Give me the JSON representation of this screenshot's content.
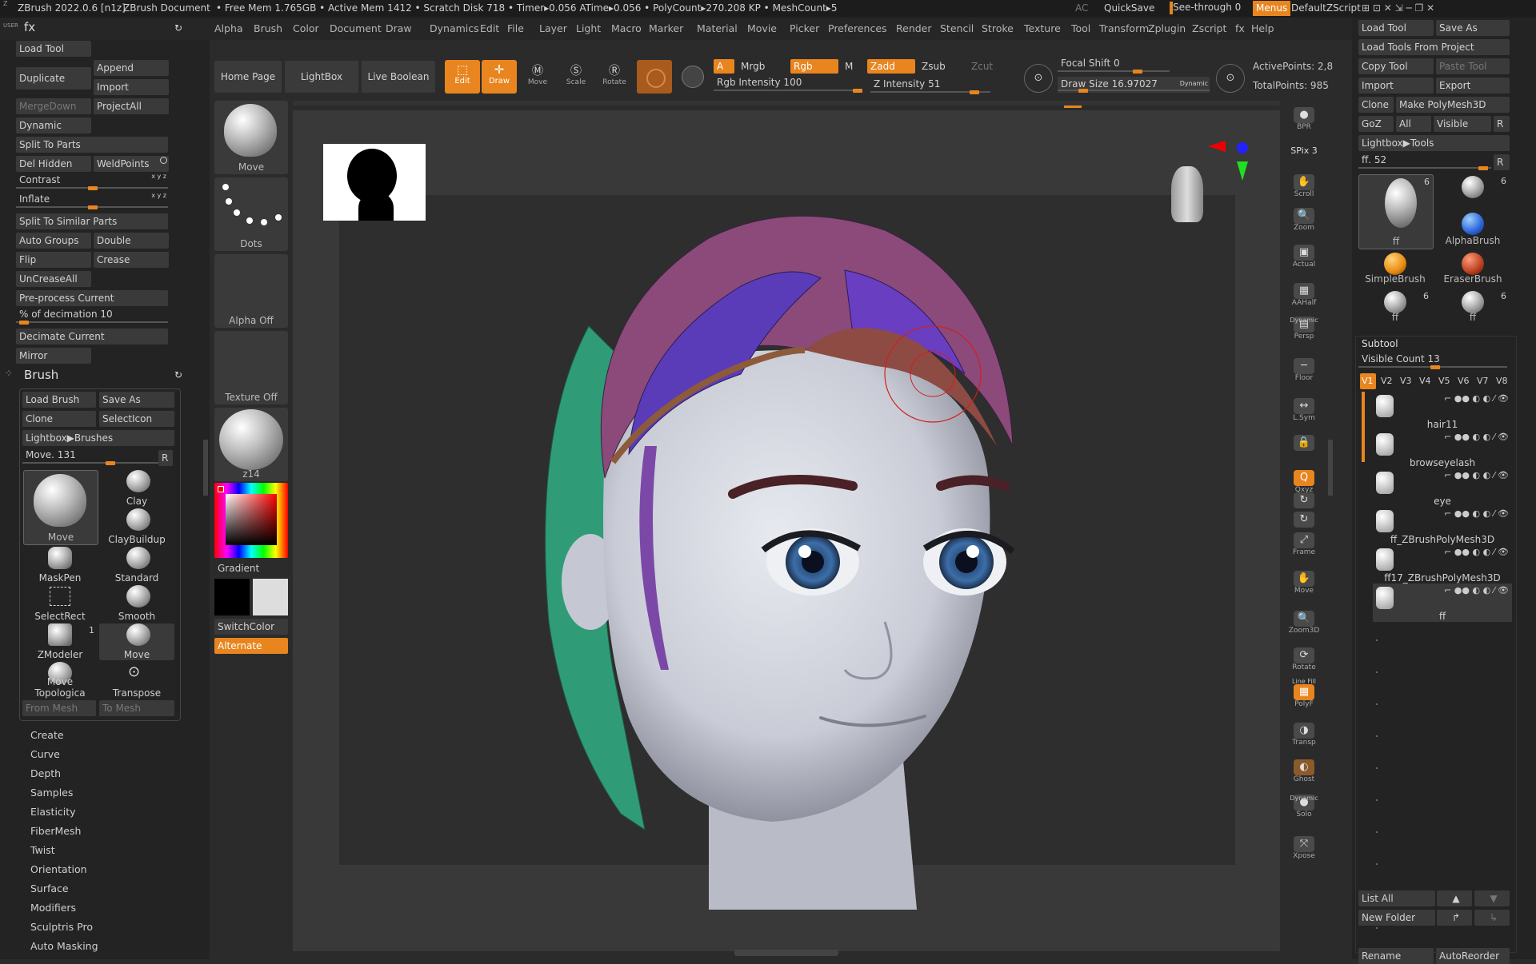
{
  "topbar": {
    "app_title": "ZBrush 2022.0.6 [n1z]",
    "document": "ZBrush Document",
    "stats": "• Free Mem 1.765GB • Active Mem 1412 • Scratch Disk 718 • Timer▸0.056 ATime▸0.056 • PolyCount▸270.208 KP • MeshCount▸5",
    "ac": "AC",
    "quicksave": "QuickSave",
    "see_through": "See-through  0",
    "menus": "Menus",
    "default_script": "DefaultZScript"
  },
  "menu": [
    "Alpha",
    "Brush",
    "Color",
    "Document",
    "Draw",
    "Dynamics",
    "Edit",
    "File",
    "Layer",
    "Light",
    "Macro",
    "Marker",
    "Material",
    "Movie",
    "Picker",
    "Preferences",
    "Render",
    "Stencil",
    "Stroke",
    "Texture",
    "Tool",
    "Transform",
    "Zplugin",
    "Zscript",
    "fx",
    "Help"
  ],
  "left": {
    "user": "USER",
    "fx": "fx",
    "buttons": {
      "load_tool": "Load Tool",
      "duplicate": "Duplicate",
      "append": "Append",
      "import": "Import",
      "mergedown": "MergeDown",
      "projectall": "ProjectAll",
      "dynamic": "Dynamic",
      "split_to_parts": "Split To Parts",
      "del_hidden": "Del Hidden",
      "weldpoints": "WeldPoints",
      "split_similar": "Split To Similar Parts",
      "auto_groups": "Auto Groups",
      "double": "Double",
      "flip": "Flip",
      "crease": "Crease",
      "uncreaseall": "UnCreaseAll",
      "preprocess": "Pre-process Current",
      "decimate_current": "Decimate Current",
      "mirror": "Mirror"
    },
    "contrast": "Contrast",
    "inflate": "Inflate",
    "xyz": "x y z",
    "decimation": "% of decimation 10",
    "brush_header": "Brush",
    "brush": {
      "load_brush": "Load Brush",
      "save_as": "Save As",
      "clone": "Clone",
      "select_icon": "SelectIcon",
      "lightbox": "Lightbox▶Brushes",
      "move_value": "Move. 131",
      "r": "R",
      "items": [
        "Move",
        "Clay",
        "ClayBuildup",
        "MaskPen",
        "Standard",
        "SelectRect",
        "Smooth",
        "ZModeler",
        "Move",
        "Move Topologica",
        "Transpose"
      ],
      "zmodeler_count": "1",
      "from_mesh": "From Mesh",
      "to_mesh": "To Mesh"
    },
    "subpalettes": [
      "Create",
      "Curve",
      "Depth",
      "Samples",
      "Elasticity",
      "FiberMesh",
      "Twist",
      "Orientation",
      "Surface",
      "Modifiers",
      "Sculptris Pro",
      "Auto Masking"
    ]
  },
  "shelf": {
    "home_page": "Home Page",
    "lightbox": "LightBox",
    "live_boolean": "Live Boolean",
    "edit": "Edit",
    "draw": "Draw",
    "move": "Move",
    "scale": "Scale",
    "rotate": "Rotate",
    "a": "A",
    "mrgb": "Mrgb",
    "rgb": "Rgb",
    "m": "M",
    "rgb_intensity": "Rgb Intensity 100",
    "zadd": "Zadd",
    "zsub": "Zsub",
    "zcut": "Zcut",
    "z_intensity": "Z Intensity 51",
    "focal_shift": "Focal Shift 0",
    "draw_size": "Draw Size 16.97027",
    "dynamic": "Dynamic",
    "active_points": "ActivePoints: 2,8",
    "total_points": "TotalPoints: 985"
  },
  "leftshelf": {
    "move": "Move",
    "dots": "Dots",
    "alpha_off": "Alpha Off",
    "texture_off": "Texture Off",
    "material": "z14",
    "gradient": "Gradient",
    "switch_color": "SwitchColor",
    "alternate": "Alternate"
  },
  "righttools": [
    "BPR",
    "SPix 3",
    "Scroll",
    "Zoom",
    "Actual",
    "AAHalf",
    "Persp",
    "Floor",
    "L.Sym",
    "",
    "Qxyz",
    "",
    "",
    "Frame",
    "Move",
    "Zoom3D",
    "Rotate",
    "PolyF",
    "Transp",
    "Ghost",
    "Solo",
    "Xpose"
  ],
  "rtool_labels": {
    "dynamic": "Dynamic",
    "line_fill": "Line Fill",
    "dynamic2": "Dynamic"
  },
  "tool": {
    "load_tool": "Load Tool",
    "save_as": "Save As",
    "load_from_project": "Load Tools From Project",
    "copy_tool": "Copy Tool",
    "paste_tool": "Paste Tool",
    "import": "Import",
    "export": "Export",
    "clone": "Clone",
    "make_polymesh": "Make PolyMesh3D",
    "goz": "GoZ",
    "all": "All",
    "visible": "Visible",
    "r": "R",
    "lightbox_tools": "Lightbox▶Tools",
    "ff_value": "ff. 52",
    "thumbs": [
      {
        "label": "ff",
        "count": "6"
      },
      {
        "label": "",
        "count": "6"
      },
      {
        "label": "AlphaBrush",
        "count": ""
      },
      {
        "label": "SimpleBrush",
        "count": ""
      },
      {
        "label": "EraserBrush",
        "count": ""
      },
      {
        "label": "ff",
        "count": "6"
      },
      {
        "label": "ff",
        "count": "6"
      }
    ]
  },
  "subtool": {
    "header": "Subtool",
    "visible_count": "Visible Count 13",
    "versions": [
      "V1",
      "V2",
      "V3",
      "V4",
      "V5",
      "V6",
      "V7",
      "V8"
    ],
    "items": [
      "hair11",
      "browseyelash",
      "eye",
      "ff_ZBrushPolyMesh3D",
      "ff17_ZBrushPolyMesh3D",
      "ff"
    ],
    "list_all": "List All",
    "new_folder": "New Folder",
    "rename": "Rename",
    "autoreorder": "AutoReorder"
  }
}
